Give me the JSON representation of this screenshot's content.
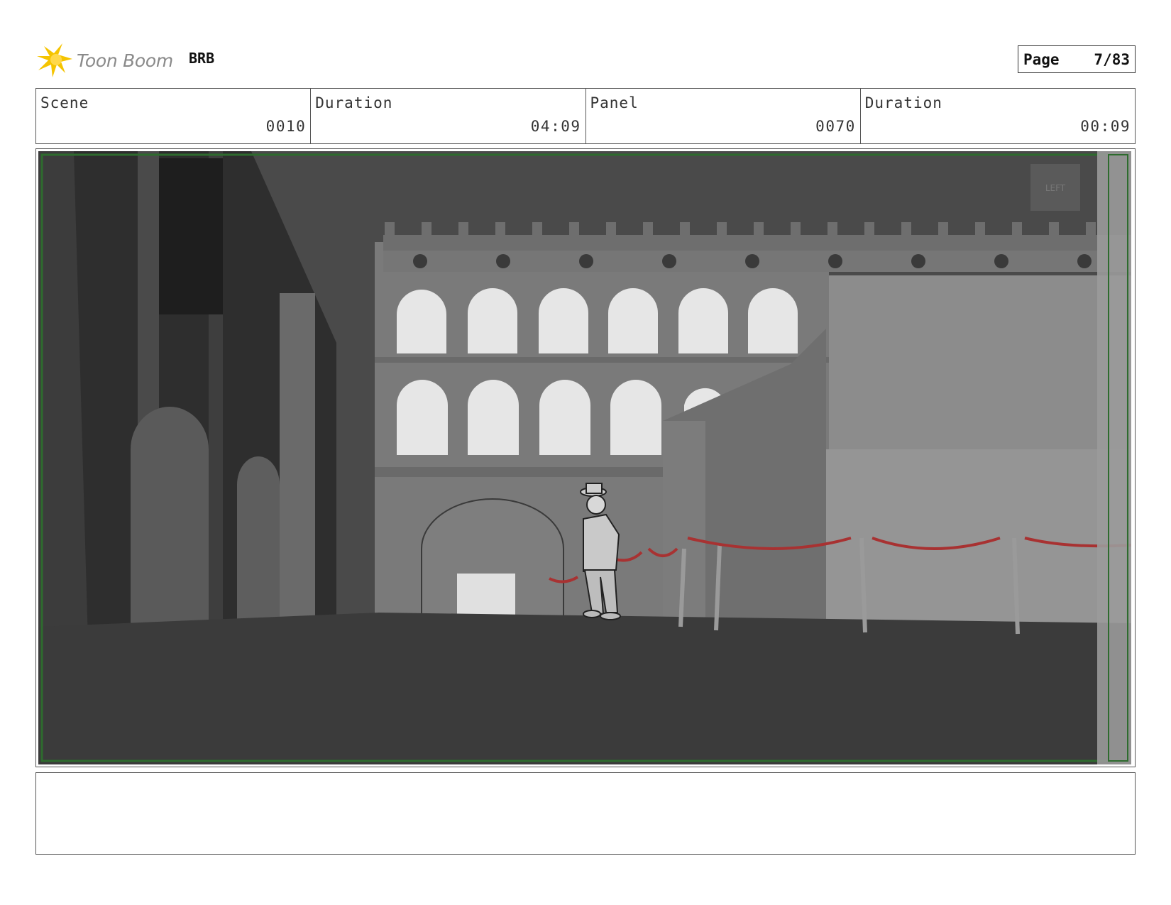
{
  "header": {
    "brand": "Toon Boom",
    "brand_icon": "toon-boom-burst-logo",
    "project": "BRB",
    "page_label": "Page",
    "page_value": "7/83"
  },
  "info": {
    "scene_label": "Scene",
    "scene_value": "0010",
    "scene_duration_label": "Duration",
    "scene_duration_value": "04:09",
    "panel_label": "Panel",
    "panel_value": "0070",
    "panel_duration_label": "Duration",
    "panel_duration_value": "00:09"
  },
  "panel": {
    "camera_marker": "LEFT"
  },
  "caption": {
    "text": ""
  },
  "colors": {
    "logo_yellow": "#f5c400",
    "safe_frame_green": "#2e6b2e",
    "rope_red": "#a83232"
  }
}
